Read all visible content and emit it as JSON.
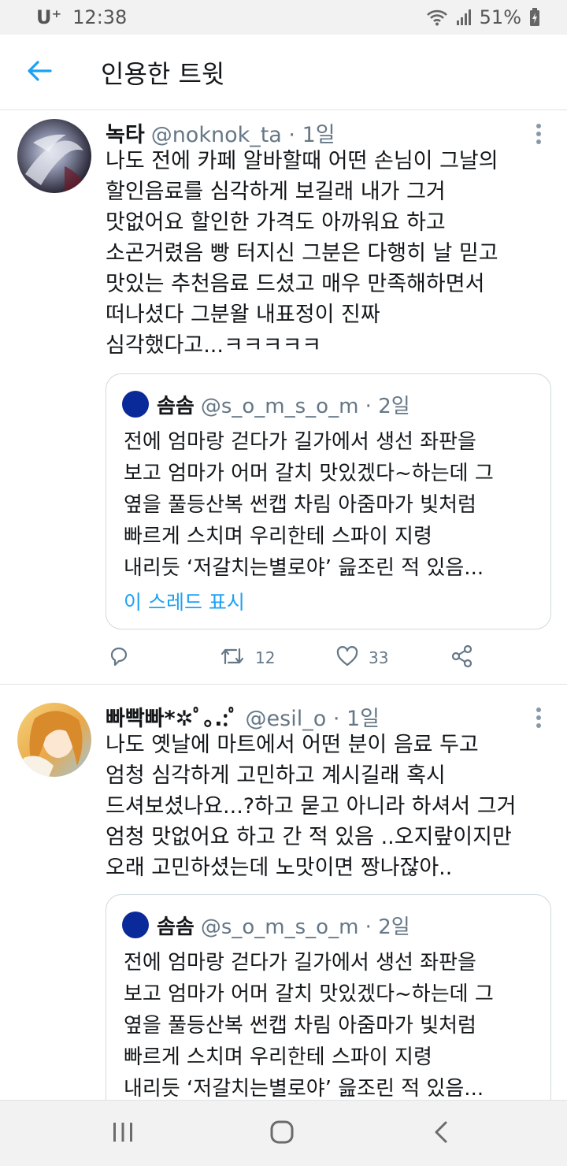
{
  "status_bar": {
    "carrier": "U⁺",
    "time": "12:38",
    "battery": "51%",
    "icons": [
      "wifi-icon",
      "signal-icon",
      "battery-charging-icon"
    ]
  },
  "header": {
    "back_icon": "arrow-left-icon",
    "title": "인용한 트윗"
  },
  "tweets": [
    {
      "name": "녹타",
      "handle": "@noknok_ta · 1일",
      "text": "나도 전에 카페 알바할때 어떤 손님이 그날의\n할인음료를 심각하게 보길래 내가 그거\n맛없어요 할인한 가격도 아까워요 하고\n소곤거렸음 빵 터지신 그분은 다행히 날 믿고\n맛있는 추천음료 드셨고 매우 만족해하면서\n떠나셨다 그분왈 내표정이 진짜\n심각했다고...ㅋㅋㅋㅋㅋ",
      "quote": {
        "name": "솜솜",
        "handle": "@s_o_m_s_o_m · 2일",
        "text": "전에 엄마랑 걷다가 길가에서 생선 좌판을\n보고 엄마가 어머 갈치 맛있겠다~하는데 그\n옆을 풀등산복 썬캡 차림 아줌마가 빛처럼\n빠르게 스치며 우리한테 스파이 지령\n내리듯 ‘저갈치는별로야’ 읊조린 적 있음...",
        "show_thread": "이 스레드 표시"
      },
      "reply_count": "",
      "retweet_count": "12",
      "like_count": "33"
    },
    {
      "name": "빠빡빠*✲ﾟ｡.:ﾟ",
      "handle": "@esil_o · 1일",
      "text": "나도 옛날에 마트에서 어떤 분이 음료 두고\n엄청 심각하게 고민하고 계시길래 혹시\n드셔보셨나요...?하고 묻고 아니라 하셔서 그거\n엄청 맛없어요 하고 간 적 있음 ..오지랖이지만\n오래 고민하셨는데 노맛이면 짱나잖아..",
      "quote": {
        "name": "솜솜",
        "handle": "@s_o_m_s_o_m · 2일",
        "text": "전에 엄마랑 걷다가 길가에서 생선 좌판을\n보고 엄마가 어머 갈치 맛있겠다~하는데 그\n옆을 풀등산복 썬캡 차림 아줌마가 빛처럼\n빠르게 스치며 우리한테 스파이 지령\n내리듯 ‘저갈치는별로야’ 읊조린 적 있음..."
      }
    }
  ],
  "nav_bar": {
    "icons": [
      "recent-apps-icon",
      "home-icon",
      "back-chevron-icon"
    ]
  },
  "colors": {
    "accent": "#1da1f2",
    "secondary_text": "#657786",
    "quote_avatar": "#0a2a9a"
  }
}
